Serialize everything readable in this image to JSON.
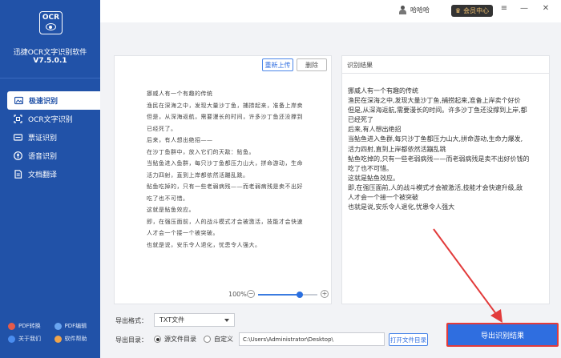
{
  "app": {
    "logo_text": "OCR",
    "name": "迅捷OCR文字识别软件",
    "version": "V7.5.0.1"
  },
  "sidebar": {
    "items": [
      {
        "label": "极速识别",
        "icon": "image-icon",
        "active": true
      },
      {
        "label": "OCR文字识别",
        "icon": "ocr-scan-icon",
        "active": false
      },
      {
        "label": "票证识别",
        "icon": "ticket-icon",
        "active": false
      },
      {
        "label": "语音识别",
        "icon": "mic-icon",
        "active": false
      },
      {
        "label": "文档翻译",
        "icon": "translate-icon",
        "active": false
      }
    ],
    "bottom_links": [
      {
        "label": "PDF转换",
        "color": "#e45b4a"
      },
      {
        "label": "PDF编辑",
        "color": "#6aa5f0"
      },
      {
        "label": "关于我们",
        "color": "#4a8df0"
      },
      {
        "label": "软件帮助",
        "color": "#f0a44a"
      }
    ]
  },
  "topbar": {
    "username": "哈哈哈",
    "vip_label": "会员中心",
    "controls": [
      "≡",
      "—",
      "✕"
    ]
  },
  "left_panel": {
    "reupload_label": "重新上传",
    "delete_label": "删除",
    "doc_lines": [
      "挪威人有一个有趣的传统",
      "渔民在深海之中，发现大量沙丁鱼，捕捞起来，准备上岸卖个好价",
      "但是，从深海返航，需要漫长的时间，许多沙丁鱼还没撑到上岸，都",
      "已经死了。",
      "后来，有人想出绝招——",
      "在沙丁鱼群中，放入它们的天敌：鲇鱼。",
      "当鲇鱼进入鱼群，每只沙丁鱼都压力山大，拼命游动，生命力爆发，",
      "活力四射，直到上岸都依然活蹦乱跳。",
      "鲇鱼吃掉的，只有一些老弱病残——而老弱病残是卖不出好价钱的",
      "吃了也不可惜。",
      "这就是鲇鱼效应。",
      "即，在强压面前，人的战斗模式才会被激活，技能才会快速升级，",
      "人才会一个接一个被突破。",
      "也就是说，安乐令人退化，忧患令人强大。"
    ],
    "zoom_pct": "100%",
    "zoom_value": 0.7
  },
  "right_panel": {
    "title": "识别结果",
    "lines": [
      "挪威人有一个有趣的传统",
      "渔民在深海之中,发现大量沙丁鱼,捕捞起来,准备上岸卖个好价",
      "但是,从深海返航,需要漫长的时间。许多沙丁鱼还没撑到上岸,都",
      "已经死了",
      "后来,有人想出绝招",
      "当鲇鱼进入鱼群,每只沙丁鱼都压力山大,拼命游动,生命力爆发,",
      "活力四射,直到上岸都依然活蹦乱跳",
      "鲇鱼吃掉的,只有一些老弱病残——而老弱病残是卖不出好价钱的",
      "吃了也不可惜。",
      "这就是鲇鱼效应。",
      "即,在强压面前,人的战斗模式才会被激活,技能才会快速升级,敌",
      "人才会一个接一个被突破",
      "也就是说,安乐令人退化,忧患令人强大"
    ]
  },
  "export": {
    "format_label": "导出格式：",
    "format_value": "TXT文件",
    "dir_label": "导出目录：",
    "radio_source": "源文件目录",
    "radio_custom": "自定义",
    "path_value": "C:\\Users\\Administrator\\Desktop\\",
    "open_dir_label": "打开文件目录",
    "export_button_label": "导出识别结果"
  },
  "colors": {
    "sidebar_bg": "#2152a8",
    "accent": "#2f6ee0",
    "highlight_red": "#e23b3b"
  }
}
